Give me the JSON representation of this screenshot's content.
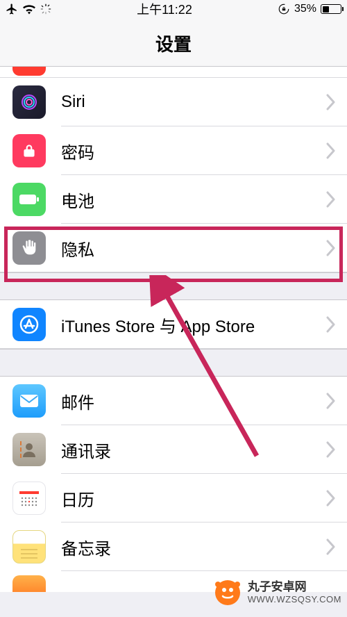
{
  "status": {
    "time": "上午11:22",
    "battery_pct": "35%"
  },
  "nav": {
    "title": "设置"
  },
  "rows": {
    "siri": "Siri",
    "passcode": "密码",
    "battery": "电池",
    "privacy": "隐私",
    "itunes": "iTunes Store 与 App Store",
    "mail": "邮件",
    "contacts": "通讯录",
    "calendar": "日历",
    "notes": "备忘录"
  },
  "watermark": {
    "line1": "丸子安卓网",
    "line2": "WWW.WZSQSY.COM"
  }
}
